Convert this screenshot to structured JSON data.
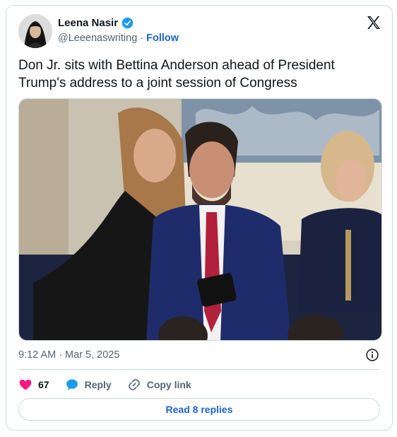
{
  "author": {
    "name": "Leena Nasir",
    "handle": "@Leeenaswriting",
    "separator": "·",
    "follow_label": "Follow"
  },
  "tweet": {
    "text": "Don Jr. sits with Bettina Anderson ahead of President Trump's address to a joint session of Congress"
  },
  "meta": {
    "time": "9:12 AM",
    "separator": "·",
    "date": "Mar 5, 2025"
  },
  "actions": {
    "likes": "67",
    "reply_label": "Reply",
    "copy_link_label": "Copy link"
  },
  "read_replies_label": "Read 8 replies",
  "colors": {
    "accent": "#1d62d0",
    "like": "#f91880",
    "verified": "#1d9bf0"
  },
  "icons": [
    "verified-badge-icon",
    "x-logo-icon",
    "info-icon",
    "heart-icon",
    "reply-bubble-icon",
    "link-icon"
  ]
}
